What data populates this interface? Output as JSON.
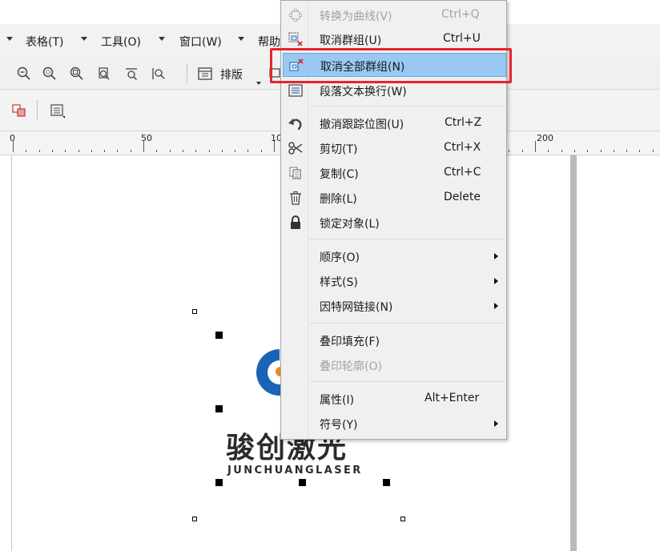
{
  "menubar": {
    "items": [
      {
        "label": "表格(T)"
      },
      {
        "label": "工具(O)"
      },
      {
        "label": "窗口(W)"
      },
      {
        "label": "帮助"
      }
    ]
  },
  "toolbar": {
    "paiban_label": "排版"
  },
  "ruler": {
    "labels": [
      "0",
      "50",
      "10",
      "200"
    ]
  },
  "logo": {
    "chinese": "骏创激光",
    "english": "JUNCHUANGLASER"
  },
  "context_menu": {
    "items": [
      {
        "label": "转换为曲线(V)",
        "shortcut": "Ctrl+Q",
        "icon": "convert-to-curves-icon",
        "disabled": true
      },
      {
        "label": "取消群组(U)",
        "shortcut": "Ctrl+U",
        "icon": "ungroup-icon"
      },
      {
        "label": "取消全部群组(N)",
        "shortcut": "",
        "icon": "ungroup-all-icon",
        "highlighted": true
      },
      {
        "label": "段落文本换行(W)",
        "shortcut": "",
        "icon": "wrap-text-icon"
      },
      {
        "label": "撤消跟踪位图(U)",
        "shortcut": "Ctrl+Z",
        "icon": "undo-icon"
      },
      {
        "label": "剪切(T)",
        "shortcut": "Ctrl+X",
        "icon": "scissors-icon"
      },
      {
        "label": "复制(C)",
        "shortcut": "Ctrl+C",
        "icon": "copy-icon"
      },
      {
        "label": "删除(L)",
        "shortcut": "Delete",
        "icon": "trash-icon"
      },
      {
        "label": "锁定对象(L)",
        "shortcut": "",
        "icon": "lock-icon"
      },
      {
        "label": "顺序(O)",
        "submenu": true
      },
      {
        "label": "样式(S)",
        "submenu": true
      },
      {
        "label": "因特网链接(N)",
        "submenu": true
      },
      {
        "label": "叠印填充(F)",
        "shortcut": ""
      },
      {
        "label": "叠印轮廓(O)",
        "shortcut": "",
        "disabled": true
      },
      {
        "label": "属性(I)",
        "shortcut": "Alt+Enter"
      },
      {
        "label": "符号(Y)",
        "submenu": true
      }
    ]
  },
  "colors": {
    "highlight": "#99c9f3",
    "annotation_red": "#e8242a",
    "logo_blue": "#1b63b5",
    "logo_orange": "#f08a24"
  }
}
